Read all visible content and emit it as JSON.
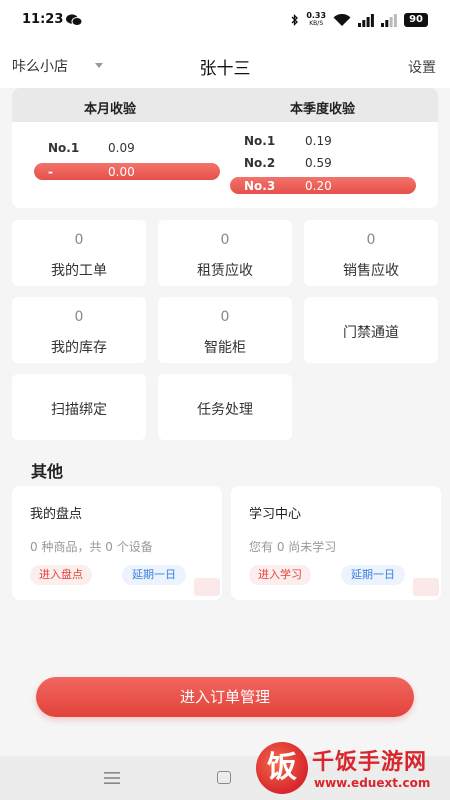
{
  "status_bar": {
    "time": "11:23",
    "net_speed_value": "0.33",
    "net_speed_unit": "KB/S",
    "battery": "90",
    "icons": [
      "wechat-icon",
      "bluetooth-icon",
      "wifi-icon",
      "signal-icon",
      "signal-icon",
      "battery-icon"
    ]
  },
  "header": {
    "shop_name": "咔么小店",
    "user_name": "张十三",
    "settings_label": "设置"
  },
  "revenue": {
    "month": {
      "title": "本月收验",
      "rows": [
        {
          "rank": "No.1",
          "value": "0.09"
        },
        {
          "rank": "-",
          "value": "0.00"
        }
      ]
    },
    "quarter": {
      "title": "本季度收验",
      "rows": [
        {
          "rank": "No.1",
          "value": "0.19"
        },
        {
          "rank": "No.2",
          "value": "0.59"
        },
        {
          "rank": "No.3",
          "value": "0.20"
        }
      ]
    }
  },
  "tiles": [
    {
      "count": "0",
      "label": "我的工单"
    },
    {
      "count": "0",
      "label": "租赁应收"
    },
    {
      "count": "0",
      "label": "销售应收"
    },
    {
      "count": "0",
      "label": "我的库存"
    },
    {
      "count": "0",
      "label": "智能柜"
    },
    {
      "label": "门禁通道"
    },
    {
      "label": "扫描绑定"
    },
    {
      "label": "任务处理"
    }
  ],
  "other": {
    "title": "其他",
    "cards": [
      {
        "title": "我的盘点",
        "subtitle": "0 种商品，共 0 个设备",
        "primary_action": "进入盘点",
        "secondary_action": "延期一日"
      },
      {
        "title": "学习中心",
        "subtitle": "您有 0 尚未学习",
        "primary_action": "进入学习",
        "secondary_action": "延期一日"
      }
    ]
  },
  "primary_button": "进入订单管理",
  "watermark": {
    "logo_char": "饭",
    "title": "千饭手游网",
    "url": "www.eduext.com"
  },
  "colors": {
    "accent": "#e2433b",
    "secondary": "#3a80dc",
    "background": "#f5f5f5"
  }
}
